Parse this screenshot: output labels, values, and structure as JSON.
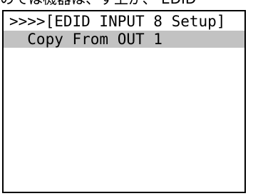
{
  "top_caption": "のでは機器は、ず上が、 EDID",
  "lcd": {
    "title": ">>>>[EDID INPUT 8 Setup]",
    "selected_item": "  Copy From OUT 1"
  },
  "colors": {
    "border": "#000000",
    "background": "#ffffff",
    "highlight": "#c2c2c2",
    "text": "#000000"
  }
}
